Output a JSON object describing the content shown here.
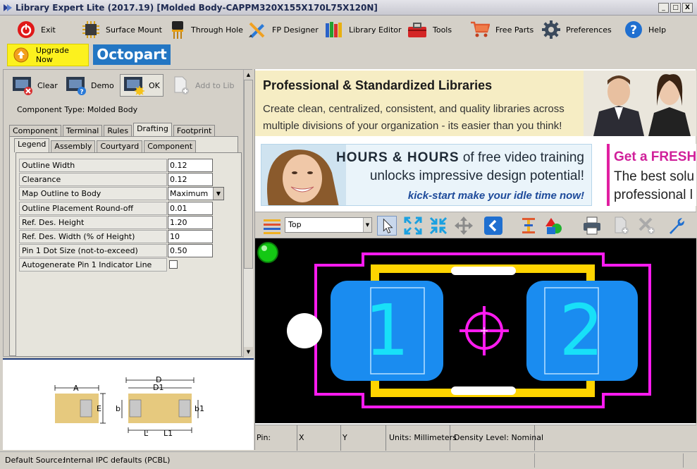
{
  "window": {
    "title": "Library Expert Lite (2017.19) [Molded Body-CAPPM320X155X170L75X120N]",
    "controls": [
      "_",
      "□",
      "X"
    ]
  },
  "toolbar": {
    "items": [
      {
        "label": "Exit",
        "icon": "power-icon"
      },
      {
        "label": "Surface Mount",
        "icon": "chip-icon"
      },
      {
        "label": "Through Hole",
        "icon": "through-hole-icon"
      },
      {
        "label": "FP Designer",
        "icon": "designer-icon"
      },
      {
        "label": "Library Editor",
        "icon": "books-icon"
      },
      {
        "label": "Tools",
        "icon": "toolbox-icon"
      },
      {
        "label": "Free Parts",
        "icon": "cart-icon"
      },
      {
        "label": "Preferences",
        "icon": "gear-icon"
      },
      {
        "label": "Help",
        "icon": "help-icon"
      }
    ],
    "upgrade_label": "Upgrade Now",
    "octopart_label": "Octopart"
  },
  "actions": {
    "clear": "Clear",
    "demo": "Demo",
    "ok": "OK",
    "add_to_lib": "Add to Lib"
  },
  "component_type": "Component Type: Molded Body",
  "tabs_top": [
    "Component",
    "Terminal",
    "Rules",
    "Drafting",
    "Footprint"
  ],
  "tabs_top_selected": "Drafting",
  "tabs_sub": [
    "Legend",
    "Assembly",
    "Courtyard",
    "Component"
  ],
  "tabs_sub_selected": "Legend",
  "params": [
    {
      "label": "Outline Width",
      "value": "0.12",
      "kind": "text"
    },
    {
      "label": "Clearance",
      "value": "0.12",
      "kind": "text"
    },
    {
      "label": "Map Outline to Body",
      "value": "Maximum",
      "kind": "combo"
    },
    {
      "label": "Outline Placement Round-off",
      "value": "0.01",
      "kind": "text"
    },
    {
      "label": "Ref. Des. Height",
      "value": "1.20",
      "kind": "text"
    },
    {
      "label": "Ref. Des. Width (% of Height)",
      "value": "10",
      "kind": "text"
    },
    {
      "label": "Pin 1 Dot Size (not-to-exceed)",
      "value": "0.50",
      "kind": "text"
    },
    {
      "label": "Autogenerate Pin 1 Indicator Line",
      "value": "",
      "kind": "check",
      "checked": false
    }
  ],
  "diagram": {
    "labels": {
      "A": "A",
      "E": "E",
      "D": "D",
      "D1": "D1",
      "b": "b",
      "b1": "b1",
      "L": "L",
      "L1": "L1"
    }
  },
  "ads": {
    "ad1_heading": "Professional & Standardized Libraries",
    "ad1_line1": "Create clean, centralized, consistent, and quality libraries across",
    "ad1_line2": "multiple divisions of your organization - its easier than you think!",
    "ad2_line1_bold": "HOURS & HOURS",
    "ad2_line1_rest": " of free video training",
    "ad2_line2": "unlocks impressive design potential!",
    "ad2_line3": "kick-start make your idle time now!",
    "ad3_line1": "Get a FRESH",
    "ad3_line2": "The best solu",
    "ad3_line3": "professional l"
  },
  "canvas": {
    "layer": "Top",
    "pads": [
      "1",
      "2"
    ],
    "colors": {
      "background": "#000000",
      "pad": "#1a8cf0",
      "pad_number": "#18e0f8",
      "courtyard": "#ff1bf0",
      "body": "#ffd400",
      "pin1_dot": "#ffffff",
      "origin": "#ff1bf0"
    }
  },
  "status_grid": {
    "pin": "Pin:",
    "x": "X",
    "y": "Y",
    "units": "Units: Millimeters",
    "density": "Density Level: Nominal"
  },
  "statusbar": {
    "label": "Default Source:",
    "value": "Internal IPC defaults (PCBL)"
  }
}
